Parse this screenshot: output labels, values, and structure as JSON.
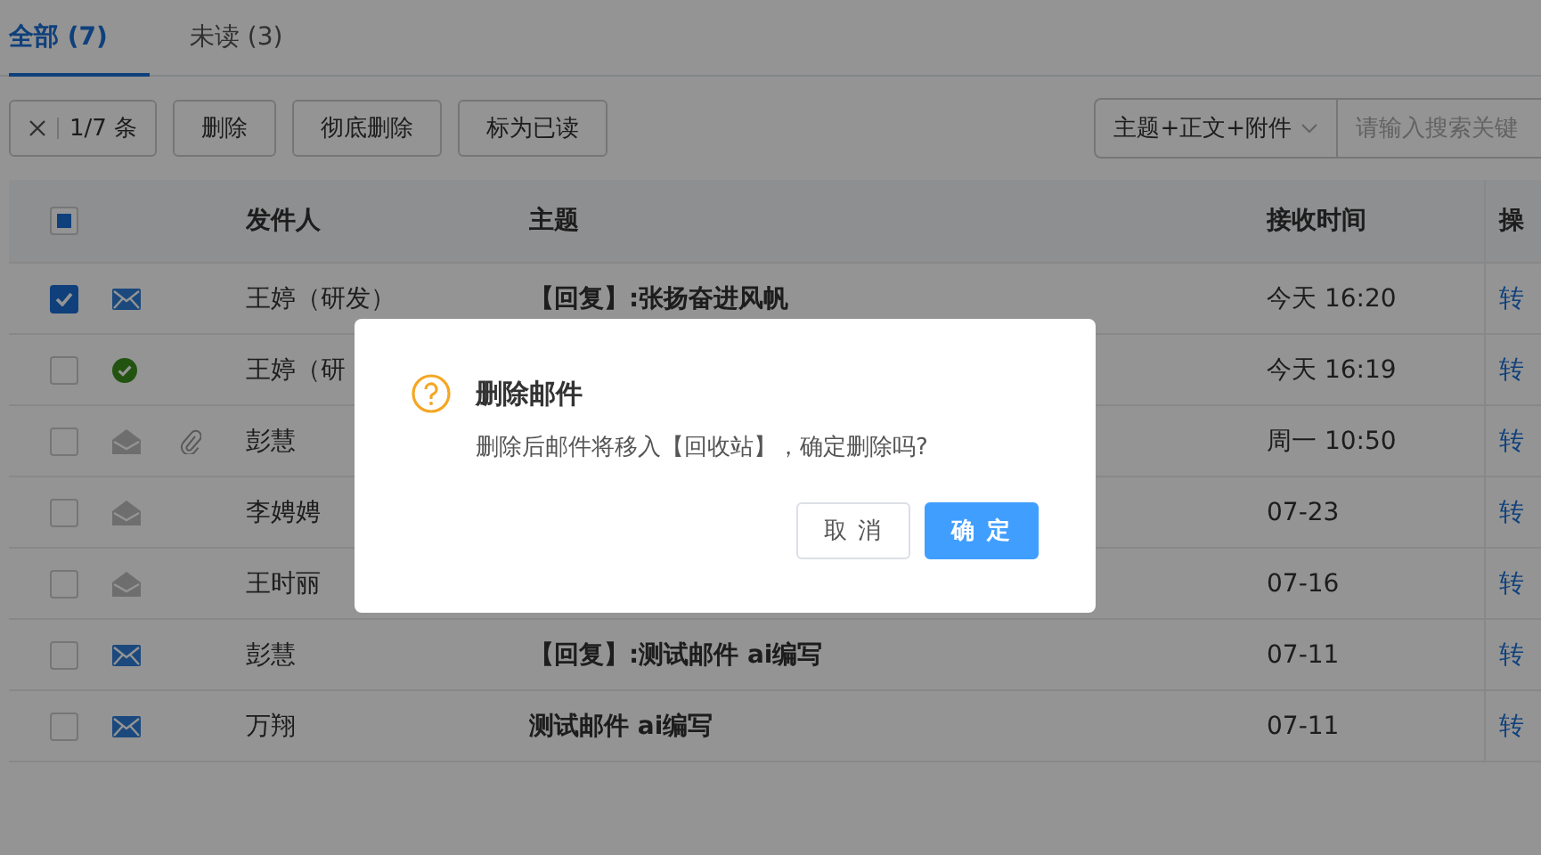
{
  "tabs": [
    {
      "label": "全部 (7)",
      "selected": true
    },
    {
      "label": "未读 (3)",
      "selected": false
    }
  ],
  "toolbar": {
    "selection_count": "1/7 条",
    "buttons": [
      "删除",
      "彻底删除",
      "标为已读"
    ],
    "search_scope": "主题+正文+附件",
    "search": {
      "placeholder": "请输入搜索关键"
    }
  },
  "table": {
    "select_all_indeterminate": true,
    "columns": [
      "发件人",
      "主题",
      "接收时间",
      "操"
    ],
    "rows": [
      {
        "checked": true,
        "kind": "unread",
        "attachment": false,
        "sender": "王婷（研发）",
        "subject": "【回复】:张扬奋进风帆",
        "time": "今天 16:20",
        "action": "转"
      },
      {
        "checked": false,
        "kind": "replied",
        "attachment": false,
        "sender": "王婷（研",
        "time": "今天 16:19",
        "action": "转"
      },
      {
        "checked": false,
        "kind": "read",
        "attachment": true,
        "sender": "彭慧",
        "time": "周一 10:50",
        "action": "转"
      },
      {
        "checked": false,
        "kind": "read",
        "attachment": false,
        "sender": "李娉娉",
        "time": "07-23",
        "action": "转"
      },
      {
        "checked": false,
        "kind": "read",
        "attachment": false,
        "sender": "王时丽",
        "time": "07-16",
        "action": "转"
      },
      {
        "checked": false,
        "kind": "unread",
        "attachment": false,
        "sender": "彭慧",
        "subject": "【回复】:测试邮件 ai编写",
        "time": "07-11",
        "action": "转"
      },
      {
        "checked": false,
        "kind": "unread",
        "attachment": false,
        "sender": "万翔",
        "subject": "测试邮件 ai编写",
        "time": "07-11",
        "action": "转"
      }
    ]
  },
  "dialog": {
    "title": "删除邮件",
    "message": "删除后邮件将移入【回收站】，确定删除吗?",
    "buttons": [
      {
        "label": "取 消",
        "kind": "default"
      },
      {
        "label": "确 定",
        "kind": "primary"
      }
    ]
  }
}
